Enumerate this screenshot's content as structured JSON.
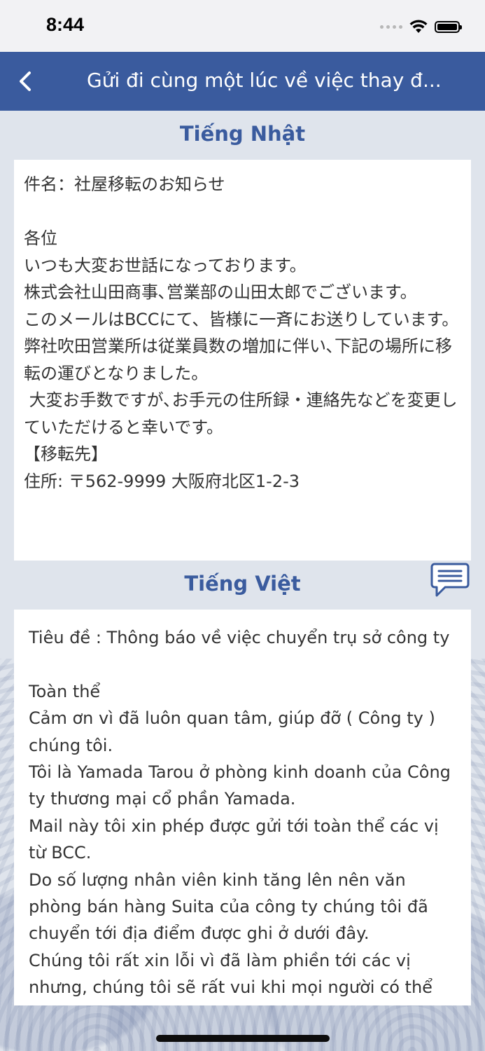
{
  "status_bar": {
    "time": "8:44",
    "icons": [
      "signal-dots-icon",
      "wifi-icon",
      "battery-icon"
    ]
  },
  "nav": {
    "back_icon": "chevron-left-icon",
    "title": "Gửi đi cùng một lúc về việc thay đ..."
  },
  "japanese": {
    "heading": "Tiếng Nhật",
    "body": "件名：社屋移転のお知らせ\n\n各位\nいつも大変お世話になっております。\n株式会社山田商事､営業部の山田太郎でございます。\nこのメールはBCCにて、皆様に一斉にお送りしています。\n弊社吹田営業所は従業員数の増加に伴い､下記の場所に移転の運びとなりました。\n 大変お手数ですが､お手元の住所録・連絡先などを変更していただけると幸いです。\n【移転先】\n住所: 〒562-9999 大阪府北区1-2-3"
  },
  "vietnamese": {
    "heading": "Tiếng Việt",
    "body": "Tiêu đề : Thông báo về việc chuyển trụ sở công ty\n\nToàn thể\nCảm ơn vì đã luôn quan tâm, giúp đỡ ( Công ty ) chúng tôi.\nTôi là Yamada Tarou ở phòng kinh doanh của Công ty thương mại cổ phần Yamada.\nMail này tôi xin phép được gửi tới toàn thể các vị từ BCC.\nDo số lượng nhân viên kinh tăng lên nên văn phòng bán hàng Suita của công ty chúng tôi đã chuyển tới địa điểm được ghi ở dưới đây.\nChúng tôi rất xin lỗi vì đã làm phiền tới các vị nhưng, chúng tôi sẽ rất vui khi mọi người có thể"
  },
  "chat_button_icon": "chat-bubble-icon",
  "colors": {
    "accent": "#3a5b9e",
    "background": "#dfe4ec",
    "card": "#ffffff",
    "text": "#333333"
  }
}
